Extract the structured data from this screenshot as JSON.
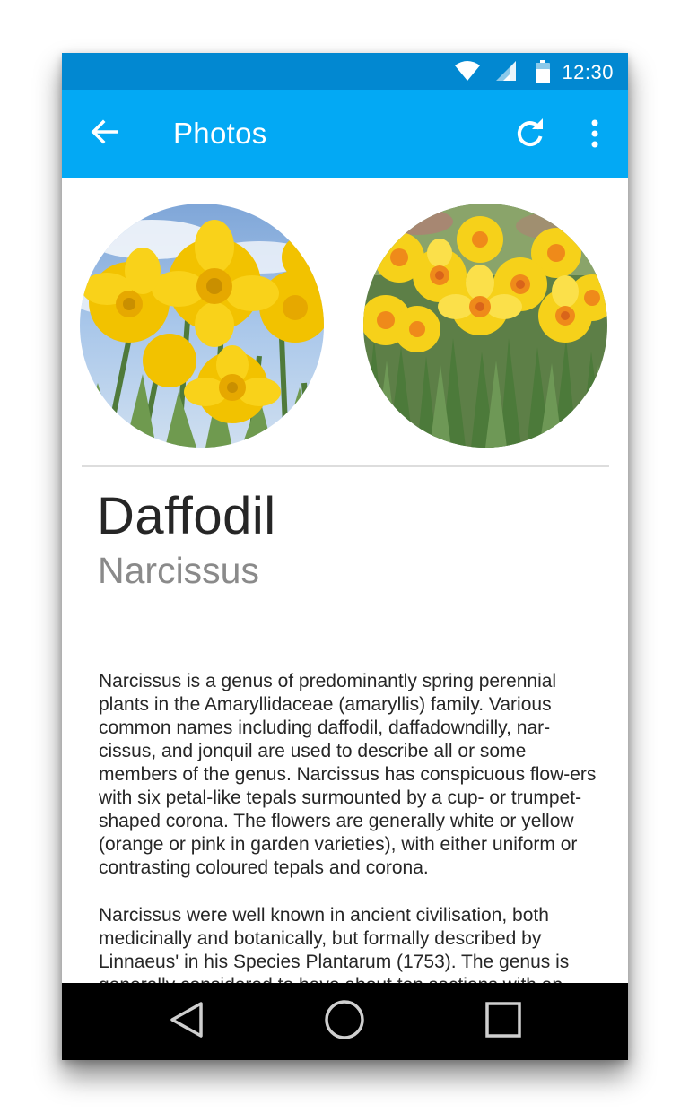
{
  "status_bar": {
    "time": "12:30",
    "icons": [
      "wifi-icon",
      "cell-signal-icon",
      "battery-icon"
    ]
  },
  "app_bar": {
    "title": "Photos",
    "icons": [
      "back-arrow-icon",
      "refresh-icon",
      "more-vert-icon"
    ]
  },
  "photos": [
    {
      "name": "daffodil-photo-sky"
    },
    {
      "name": "daffodil-photo-field"
    }
  ],
  "article": {
    "title": "Daffodil",
    "subtitle": "Narcissus",
    "paragraphs": [
      "Narcissus is a genus of predominantly spring perennial plants in the Amaryllidaceae (amaryllis) family. Various common names including daffodil, daffadowndilly, nar-cissus, and jonquil are used to describe all or some members of the genus. Narcissus has conspicuous flow-ers with six petal-like tepals surmounted by a cup- or trumpet-shaped corona. The flowers are generally white or yellow (orange or pink in garden varieties), with either uniform or contrasting coloured tepals and corona.",
      "Narcissus were well known in ancient civilisation, both medicinally and botanically, but formally described by Linnaeus' in his Species Plantarum (1753). The genus is generally considered to have about ten sections with ap-"
    ]
  },
  "nav_bar": {
    "icons": [
      "back-triangle-icon",
      "home-circle-icon",
      "recents-square-icon"
    ]
  },
  "colors": {
    "status_bar": "#0288d1",
    "app_bar": "#03a9f4",
    "title_text": "#262626",
    "subtitle_text": "#8a8a8a",
    "nav_bar": "#000000"
  }
}
